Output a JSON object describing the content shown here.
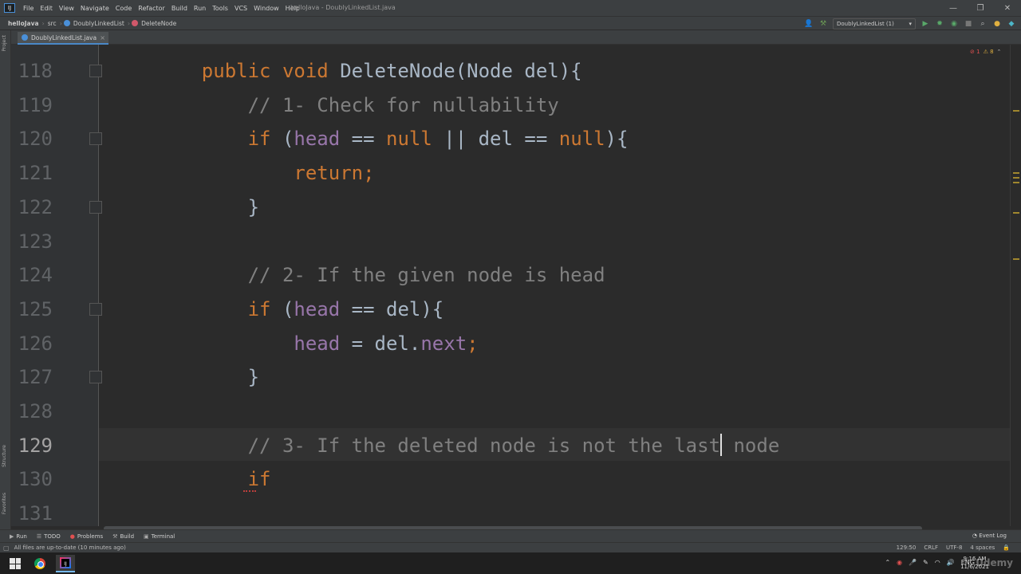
{
  "menubar": {
    "logo": "IJ",
    "items": [
      "File",
      "Edit",
      "View",
      "Navigate",
      "Code",
      "Refactor",
      "Build",
      "Run",
      "Tools",
      "VCS",
      "Window",
      "Help"
    ],
    "window_title": "helloJava - DoublyLinkedList.java",
    "controls": [
      "—",
      "❐",
      "✕"
    ]
  },
  "navbar": {
    "crumbs": [
      "helloJava",
      "src",
      "DoublyLinkedList",
      "DeleteNode"
    ],
    "run_config": "DoublyLinkedList (1)"
  },
  "tabs": [
    {
      "label": "DoublyLinkedList.java",
      "close": "×"
    }
  ],
  "left_strip": {
    "top": "Project",
    "middle": "Structure",
    "bottom": "Favorites"
  },
  "inspections": {
    "errors": "1",
    "warnings": "8"
  },
  "editor": {
    "lines": [
      {
        "num": "118",
        "tokens": [
          {
            "t": "    ",
            "c": ""
          },
          {
            "t": "public void ",
            "c": "kw"
          },
          {
            "t": "DeleteNode",
            "c": "fnd"
          },
          {
            "t": "(Node del){",
            "c": ""
          }
        ]
      },
      {
        "num": "119",
        "tokens": [
          {
            "t": "        ",
            "c": ""
          },
          {
            "t": "// 1- Check for nullability",
            "c": "cm"
          }
        ]
      },
      {
        "num": "120",
        "tokens": [
          {
            "t": "        ",
            "c": ""
          },
          {
            "t": "if ",
            "c": "kw"
          },
          {
            "t": "(",
            "c": ""
          },
          {
            "t": "head",
            "c": "field"
          },
          {
            "t": " == ",
            "c": ""
          },
          {
            "t": "null",
            "c": "kw"
          },
          {
            "t": " || del == ",
            "c": ""
          },
          {
            "t": "null",
            "c": "kw"
          },
          {
            "t": "){",
            "c": ""
          }
        ]
      },
      {
        "num": "121",
        "tokens": [
          {
            "t": "            ",
            "c": ""
          },
          {
            "t": "return;",
            "c": "kw"
          }
        ]
      },
      {
        "num": "122",
        "tokens": [
          {
            "t": "        }",
            "c": ""
          }
        ]
      },
      {
        "num": "123",
        "tokens": []
      },
      {
        "num": "124",
        "tokens": [
          {
            "t": "        ",
            "c": ""
          },
          {
            "t": "// 2- If the given node is head",
            "c": "cm"
          }
        ]
      },
      {
        "num": "125",
        "tokens": [
          {
            "t": "        ",
            "c": ""
          },
          {
            "t": "if ",
            "c": "kw"
          },
          {
            "t": "(",
            "c": ""
          },
          {
            "t": "head",
            "c": "field"
          },
          {
            "t": " == del){",
            "c": ""
          }
        ]
      },
      {
        "num": "126",
        "tokens": [
          {
            "t": "            ",
            "c": ""
          },
          {
            "t": "head",
            "c": "field"
          },
          {
            "t": " = del.",
            "c": ""
          },
          {
            "t": "next",
            "c": "field"
          },
          {
            "t": ";",
            "c": "kw"
          }
        ]
      },
      {
        "num": "127",
        "tokens": [
          {
            "t": "        }",
            "c": ""
          }
        ]
      },
      {
        "num": "128",
        "tokens": []
      },
      {
        "num": "129",
        "tokens": [
          {
            "t": "        ",
            "c": ""
          },
          {
            "t": "// 3- If the deleted node is not the last",
            "c": "cm"
          },
          {
            "t": "|caret|",
            "c": "caret"
          },
          {
            "t": " node",
            "c": "cm"
          }
        ]
      },
      {
        "num": "130",
        "tokens": [
          {
            "t": "        ",
            "c": ""
          },
          {
            "t": "if",
            "c": "kw"
          }
        ]
      },
      {
        "num": "131",
        "tokens": []
      }
    ],
    "active_line": "129"
  },
  "bottom_tools": [
    "Run",
    "TODO",
    "Problems",
    "Build",
    "Terminal"
  ],
  "event_log": "Event Log",
  "status": {
    "message": "All files are up-to-date (10 minutes ago)",
    "position": "129:50",
    "line_sep": "CRLF",
    "encoding": "UTF-8",
    "indent": "4 spaces"
  },
  "taskbar": {
    "lang": "ENG",
    "time": "9:16 AM",
    "date": "11/6/2021"
  },
  "watermark": "Udemy",
  "colors": {
    "keyword": "#cc7832",
    "comment": "#808080",
    "field": "#9876aa",
    "text": "#a9b7c6",
    "bg": "#2b2b2b"
  }
}
